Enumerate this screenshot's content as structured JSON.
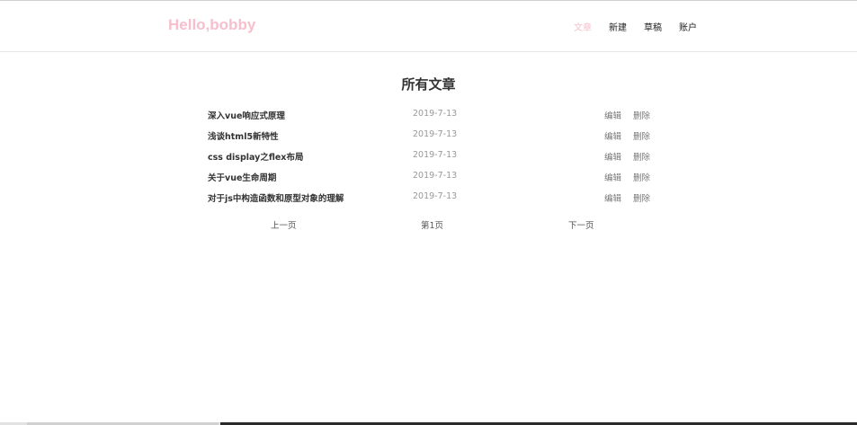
{
  "header": {
    "brand": "Hello,bobby",
    "nav": [
      {
        "label": "文章",
        "active": true
      },
      {
        "label": "新建",
        "active": false
      },
      {
        "label": "草稿",
        "active": false
      },
      {
        "label": "账户",
        "active": false
      }
    ]
  },
  "main": {
    "title": "所有文章",
    "articles": [
      {
        "title": "深入vue响应式原理",
        "date": "2019-7-13",
        "edit": "编辑",
        "delete": "删除"
      },
      {
        "title": "浅谈html5新特性",
        "date": "2019-7-13",
        "edit": "编辑",
        "delete": "删除"
      },
      {
        "title": "css display之flex布局",
        "date": "2019-7-13",
        "edit": "编辑",
        "delete": "删除"
      },
      {
        "title": "关于vue生命周期",
        "date": "2019-7-13",
        "edit": "编辑",
        "delete": "删除"
      },
      {
        "title": "对于js中构造函数和原型对象的理解",
        "date": "2019-7-13",
        "edit": "编辑",
        "delete": "删除"
      }
    ],
    "pager": {
      "prev": "上一页",
      "current": "第1页",
      "next": "下一页"
    }
  },
  "colors": {
    "accent": "#f7bfcb"
  }
}
